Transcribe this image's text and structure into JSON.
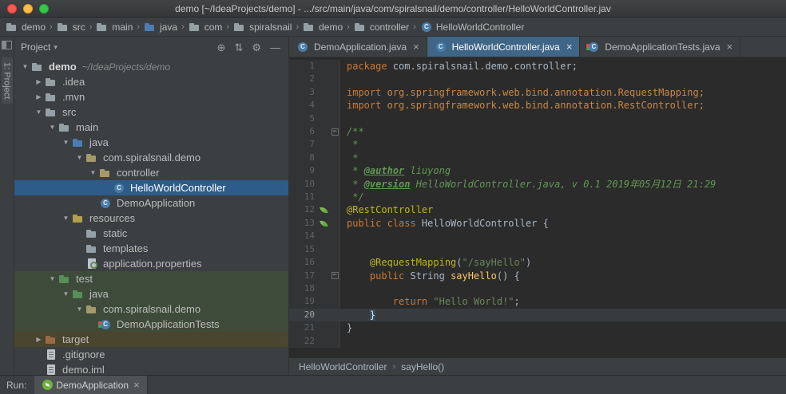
{
  "colors": {
    "editor_bg": "#2B2B2B",
    "panel_bg": "#3C3F41",
    "selection": "#2E5C8A",
    "tab_active": "#3F6587",
    "test_row": "#3E4B3A",
    "excluded_row": "#4A452F",
    "keyword": "#CC7832",
    "string": "#6A8759",
    "comment": "#629755",
    "annotation": "#BBB529",
    "method": "#FFC66B",
    "spring_green": "#6DB33F"
  },
  "title_bar": {
    "title": "demo [~/IdeaProjects/demo] - .../src/main/java/com/spiralsnail/demo/controller/HelloWorldController.jav"
  },
  "breadcrumb_bar": {
    "separator": "›",
    "items": [
      {
        "label": "demo",
        "icon": "folder"
      },
      {
        "label": "src",
        "icon": "folder"
      },
      {
        "label": "main",
        "icon": "folder"
      },
      {
        "label": "java",
        "icon": "folder-src"
      },
      {
        "label": "com",
        "icon": "folder"
      },
      {
        "label": "spiralsnail",
        "icon": "folder"
      },
      {
        "label": "demo",
        "icon": "folder"
      },
      {
        "label": "controller",
        "icon": "folder"
      },
      {
        "label": "HelloWorldController",
        "icon": "class"
      }
    ]
  },
  "tool_strip": {
    "label": "1: Project"
  },
  "project_panel": {
    "arrow_down_glyph": "▼",
    "arrow_right_glyph": "▶",
    "header": {
      "title": "Project",
      "caret_glyph": "▾",
      "actions": [
        {
          "name": "locate-icon",
          "glyph": "⊕"
        },
        {
          "name": "collapse-all-icon",
          "glyph": "⇅"
        },
        {
          "name": "settings-icon",
          "glyph": "⚙"
        },
        {
          "name": "hide-panel-icon",
          "glyph": "—"
        }
      ]
    },
    "tree": [
      {
        "indent": 0,
        "arrow": "down",
        "icon": "folder",
        "label": "demo",
        "hint": "~/IdeaProjects/demo",
        "bold": true
      },
      {
        "indent": 1,
        "arrow": "right",
        "icon": "folder",
        "label": ".idea"
      },
      {
        "indent": 1,
        "arrow": "right",
        "icon": "folder",
        "label": ".mvn"
      },
      {
        "indent": 1,
        "arrow": "down",
        "icon": "folder",
        "label": "src"
      },
      {
        "indent": 2,
        "arrow": "down",
        "icon": "folder",
        "label": "main"
      },
      {
        "indent": 3,
        "arrow": "down",
        "icon": "folder-src",
        "label": "java"
      },
      {
        "indent": 4,
        "arrow": "down",
        "icon": "package",
        "label": "com.spiralsnail.demo"
      },
      {
        "indent": 5,
        "arrow": "down",
        "icon": "package",
        "label": "controller"
      },
      {
        "indent": 6,
        "arrow": "none",
        "icon": "class",
        "label": "HelloWorldController",
        "row": "selected"
      },
      {
        "indent": 5,
        "arrow": "none",
        "icon": "class",
        "label": "DemoApplication"
      },
      {
        "indent": 3,
        "arrow": "down",
        "icon": "folder-res",
        "label": "resources"
      },
      {
        "indent": 4,
        "arrow": "none",
        "icon": "folder",
        "label": "static"
      },
      {
        "indent": 4,
        "arrow": "none",
        "icon": "folder",
        "label": "templates"
      },
      {
        "indent": 4,
        "arrow": "none",
        "icon": "properties",
        "label": "application.properties"
      },
      {
        "indent": 2,
        "arrow": "down",
        "icon": "folder-test",
        "label": "test",
        "row": "test"
      },
      {
        "indent": 3,
        "arrow": "down",
        "icon": "folder-test",
        "label": "java",
        "row": "test"
      },
      {
        "indent": 4,
        "arrow": "down",
        "icon": "package",
        "label": "com.spiralsnail.demo",
        "row": "test"
      },
      {
        "indent": 5,
        "arrow": "none",
        "icon": "test-class",
        "label": "DemoApplicationTests",
        "row": "test"
      },
      {
        "indent": 1,
        "arrow": "right",
        "icon": "folder-excluded",
        "label": "target",
        "row": "excluded"
      },
      {
        "indent": 1,
        "arrow": "none",
        "icon": "file",
        "label": ".gitignore"
      },
      {
        "indent": 1,
        "arrow": "none",
        "icon": "file",
        "label": "demo.iml"
      }
    ]
  },
  "editor": {
    "close_glyph": "×",
    "fold_glyph": "−",
    "breadcrumb_separator": "›",
    "tabs": [
      {
        "label": "DemoApplication.java",
        "icon": "class",
        "active": false
      },
      {
        "label": "HelloWorldController.java",
        "icon": "class",
        "active": true
      },
      {
        "label": "DemoApplicationTests.java",
        "icon": "test-class",
        "active": false
      }
    ],
    "code_lines": [
      {
        "n": 1,
        "tokens": [
          [
            "kw",
            "package "
          ],
          [
            "pl",
            "com.spiralsnail.demo.controller;"
          ]
        ]
      },
      {
        "n": 2,
        "tokens": []
      },
      {
        "n": 3,
        "tokens": [
          [
            "kw",
            "import "
          ],
          [
            "imp",
            "org.springframework.web.bind.annotation.RequestMapping;"
          ]
        ]
      },
      {
        "n": 4,
        "tokens": [
          [
            "kw",
            "import "
          ],
          [
            "imp",
            "org.springframework.web.bind.annotation.RestController;"
          ]
        ]
      },
      {
        "n": 5,
        "tokens": []
      },
      {
        "n": 6,
        "fold": true,
        "tokens": [
          [
            "com",
            "/**"
          ]
        ]
      },
      {
        "n": 7,
        "tokens": [
          [
            "com",
            " *"
          ]
        ]
      },
      {
        "n": 8,
        "tokens": [
          [
            "com",
            " *"
          ]
        ]
      },
      {
        "n": 9,
        "tokens": [
          [
            "com",
            " * "
          ],
          [
            "tag",
            "@author"
          ],
          [
            "com",
            " liuyong"
          ]
        ]
      },
      {
        "n": 10,
        "tokens": [
          [
            "com",
            " * "
          ],
          [
            "tag",
            "@version"
          ],
          [
            "com",
            " HelloWorldController.java, v 0.1 2019年05月12日 21:29"
          ]
        ]
      },
      {
        "n": 11,
        "tokens": [
          [
            "com",
            " */"
          ]
        ]
      },
      {
        "n": 12,
        "icon": "spring",
        "tokens": [
          [
            "ann",
            "@RestController"
          ]
        ]
      },
      {
        "n": 13,
        "icon": "spring",
        "tokens": [
          [
            "kw",
            "public class "
          ],
          [
            "pl",
            "HelloWorldController {"
          ]
        ]
      },
      {
        "n": 14,
        "tokens": []
      },
      {
        "n": 15,
        "tokens": []
      },
      {
        "n": 16,
        "tokens": [
          [
            "pl",
            "    "
          ],
          [
            "ann",
            "@RequestMapping"
          ],
          [
            "pl",
            "("
          ],
          [
            "str",
            "\"/sayHello\""
          ],
          [
            "pl",
            ")"
          ]
        ]
      },
      {
        "n": 17,
        "fold": true,
        "tokens": [
          [
            "pl",
            "    "
          ],
          [
            "kw",
            "public "
          ],
          [
            "pl",
            "String "
          ],
          [
            "meth",
            "sayHello"
          ],
          [
            "pl",
            "() {"
          ]
        ]
      },
      {
        "n": 18,
        "tokens": []
      },
      {
        "n": 19,
        "tokens": [
          [
            "pl",
            "        "
          ],
          [
            "kw",
            "return "
          ],
          [
            "str",
            "\"Hello World!\""
          ],
          [
            "pl",
            ";"
          ]
        ]
      },
      {
        "n": 20,
        "current": true,
        "tokens": [
          [
            "pl",
            "    "
          ],
          [
            "brace",
            "}"
          ]
        ]
      },
      {
        "n": 21,
        "tokens": [
          [
            "pl",
            "}"
          ]
        ]
      },
      {
        "n": 22,
        "tokens": []
      }
    ],
    "breadcrumbs": [
      "HelloWorldController",
      "sayHello()"
    ]
  },
  "run_bar": {
    "label": "Run:",
    "tab": {
      "label": "DemoApplication",
      "close": "×"
    }
  }
}
